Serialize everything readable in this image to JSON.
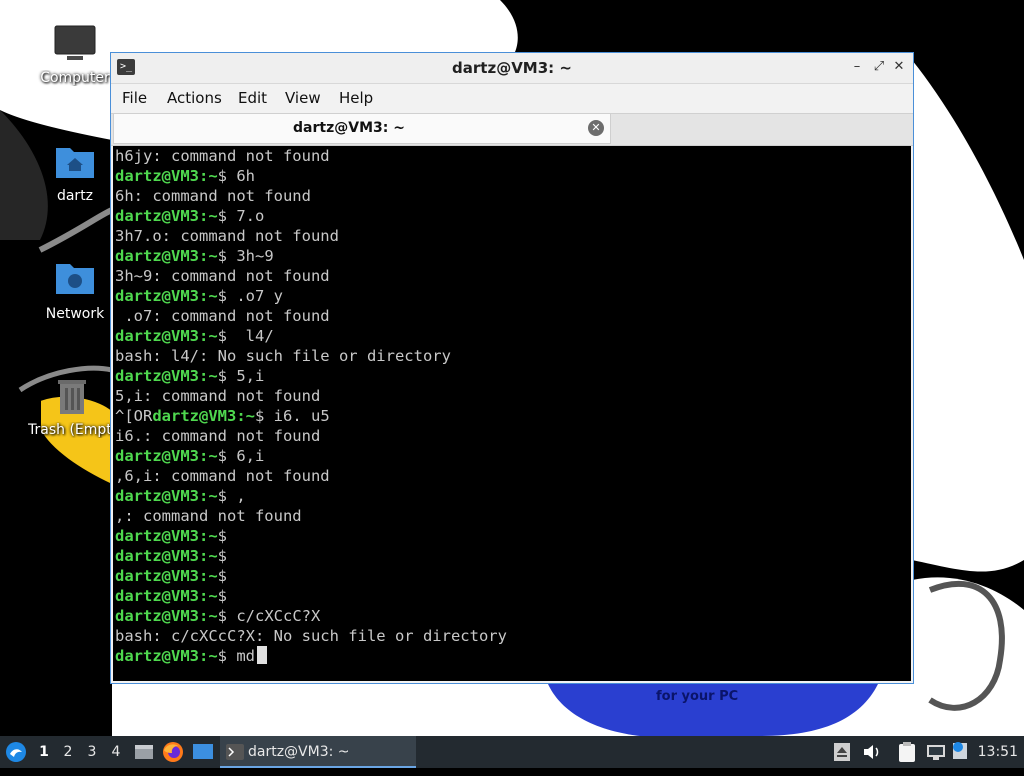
{
  "desktop": {
    "icons": [
      {
        "label": "Computer"
      },
      {
        "label": "dartz"
      },
      {
        "label": "Network"
      },
      {
        "label": "Trash (Empty)"
      }
    ],
    "wallpaper_text": "for your PC"
  },
  "window": {
    "title": "dartz@VM3: ~",
    "controls": {
      "minimize": "–",
      "maximize": "⤢",
      "close": "✕"
    },
    "menu": [
      "File",
      "Actions",
      "Edit",
      "View",
      "Help"
    ],
    "tab": {
      "title": "dartz@VM3: ~",
      "close": "✕"
    }
  },
  "terminal": {
    "colors": {
      "prompt": "#4fd84f",
      "text": "#c8c8c8",
      "background": "#000000"
    },
    "lines": [
      {
        "prefix": "",
        "prompt": "",
        "text": "h6jy: command not found"
      },
      {
        "prefix": "",
        "prompt": "dartz@VM3",
        "text": "$ 6h"
      },
      {
        "prefix": "",
        "prompt": "",
        "text": "6h: command not found"
      },
      {
        "prefix": "",
        "prompt": "dartz@VM3",
        "text": "$ 7.o"
      },
      {
        "prefix": "",
        "prompt": "",
        "text": "3h7.o: command not found"
      },
      {
        "prefix": "",
        "prompt": "dartz@VM3",
        "text": "$ 3h~9"
      },
      {
        "prefix": "",
        "prompt": "",
        "text": "3h~9: command not found"
      },
      {
        "prefix": "",
        "prompt": "dartz@VM3",
        "text": "$ .o7 y"
      },
      {
        "prefix": "",
        "prompt": "",
        "text": " .o7: command not found"
      },
      {
        "prefix": "",
        "prompt": "dartz@VM3",
        "text": "$  l4/"
      },
      {
        "prefix": "",
        "prompt": "",
        "text": "bash: l4/: No such file or directory"
      },
      {
        "prefix": "",
        "prompt": "dartz@VM3",
        "text": "$ 5,i"
      },
      {
        "prefix": "",
        "prompt": "",
        "text": "5,i: command not found"
      },
      {
        "prefix": "^[OR",
        "prompt": "dartz@VM3",
        "text": "$ i6. u5"
      },
      {
        "prefix": "",
        "prompt": "",
        "text": "i6.: command not found"
      },
      {
        "prefix": "",
        "prompt": "dartz@VM3",
        "text": "$ 6,i"
      },
      {
        "prefix": "",
        "prompt": "",
        "text": ",6,i: command not found"
      },
      {
        "prefix": "",
        "prompt": "dartz@VM3",
        "text": "$ ,"
      },
      {
        "prefix": "",
        "prompt": "",
        "text": ",: command not found"
      },
      {
        "prefix": "",
        "prompt": "dartz@VM3",
        "text": "$"
      },
      {
        "prefix": "",
        "prompt": "dartz@VM3",
        "text": "$"
      },
      {
        "prefix": "",
        "prompt": "dartz@VM3",
        "text": "$"
      },
      {
        "prefix": "",
        "prompt": "dartz@VM3",
        "text": "$"
      },
      {
        "prefix": "",
        "prompt": "dartz@VM3",
        "text": "$ c/cXCcC?X"
      },
      {
        "prefix": "",
        "prompt": "",
        "text": "bash: c/cXCcC?X: No such file or directory"
      },
      {
        "prefix": "",
        "prompt": "dartz@VM3",
        "text": "$ md",
        "cursor": true
      }
    ]
  },
  "taskbar": {
    "workspaces": [
      "1",
      "2",
      "3",
      "4"
    ],
    "active_workspace": "1",
    "task_label": "dartz@VM3: ~",
    "clock": "13:51",
    "icons": [
      "start-menu-icon",
      "file-manager-icon",
      "firefox-icon",
      "show-desktop-icon",
      "terminal-icon",
      "eject-icon",
      "volume-icon",
      "clipboard-icon",
      "network-icon",
      "update-icon"
    ]
  }
}
